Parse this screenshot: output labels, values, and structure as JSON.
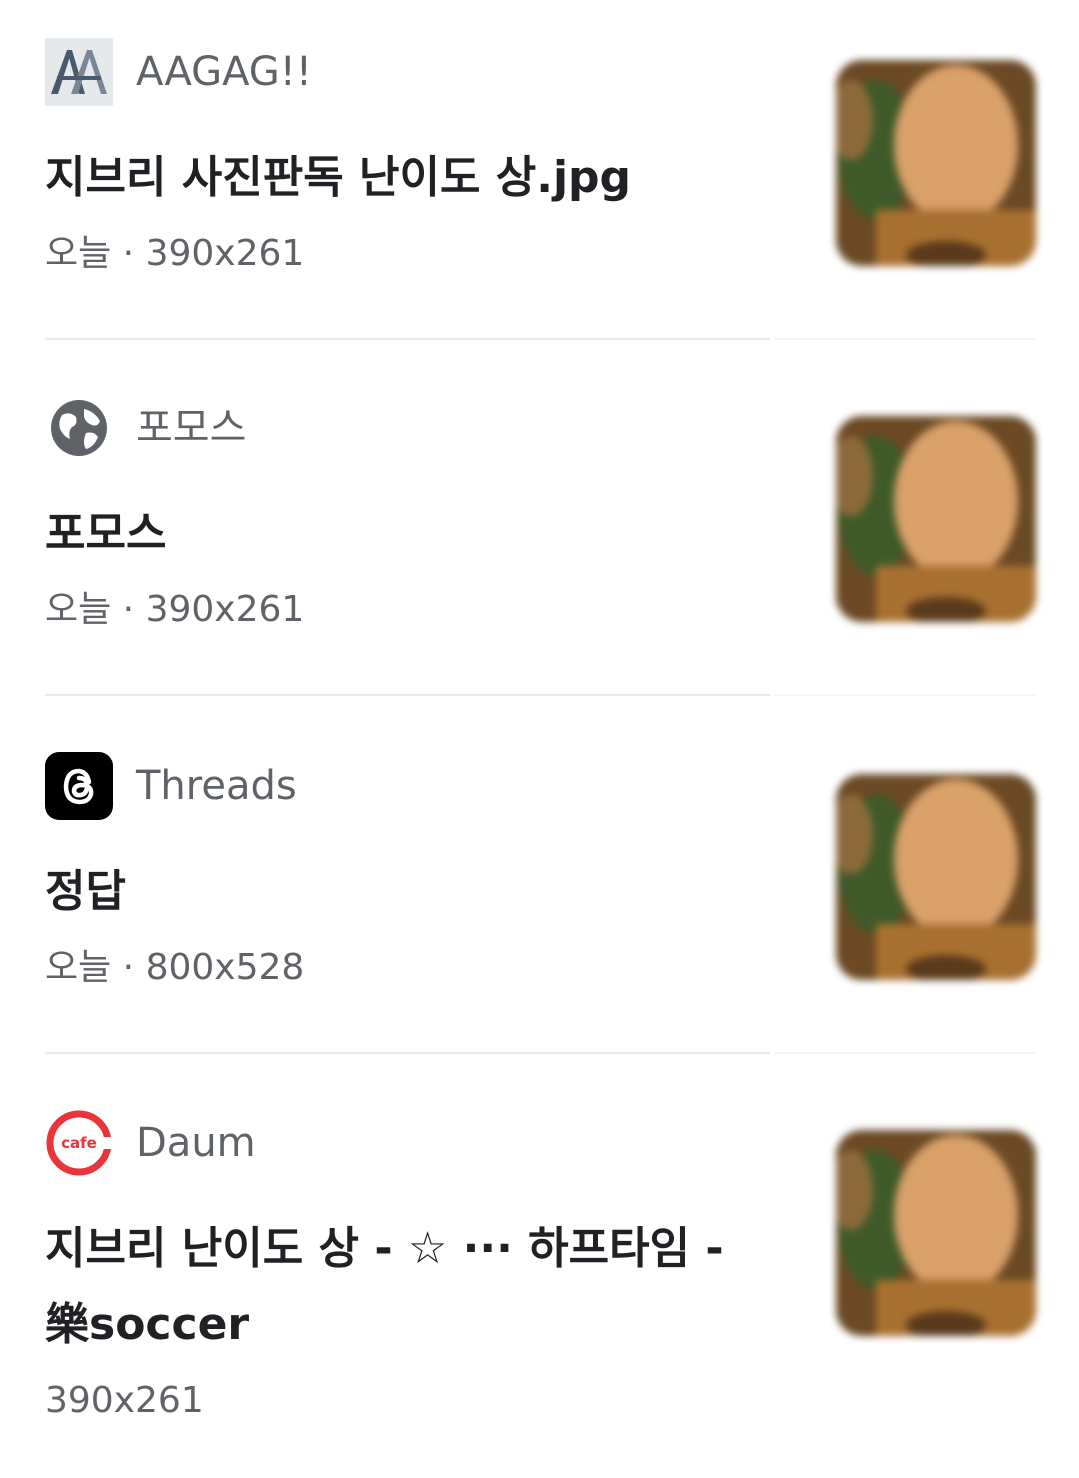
{
  "results": [
    {
      "source": "AAGAG!!",
      "source_icon": "aagag-logo-icon",
      "title": "지브리 사진판독 난이도 상.jpg",
      "meta": "오늘 · 390x261"
    },
    {
      "source": "포모스",
      "source_icon": "globe-icon",
      "title": "포모스",
      "meta": "오늘 · 390x261"
    },
    {
      "source": "Threads",
      "source_icon": "threads-logo-icon",
      "title": "정답",
      "meta": "오늘 · 800x528"
    },
    {
      "source": "Daum",
      "source_icon": "daum-cafe-logo-icon",
      "title": "지브리 난이도 상 - ☆ ··· 하프타임 - 樂soccer",
      "meta": "390x261"
    }
  ],
  "daum_logo_text": "cafe",
  "colors": {
    "title": "#202124",
    "secondary": "#5f6368",
    "divider": "#e8eaed",
    "daum_red": "#e8343a"
  }
}
